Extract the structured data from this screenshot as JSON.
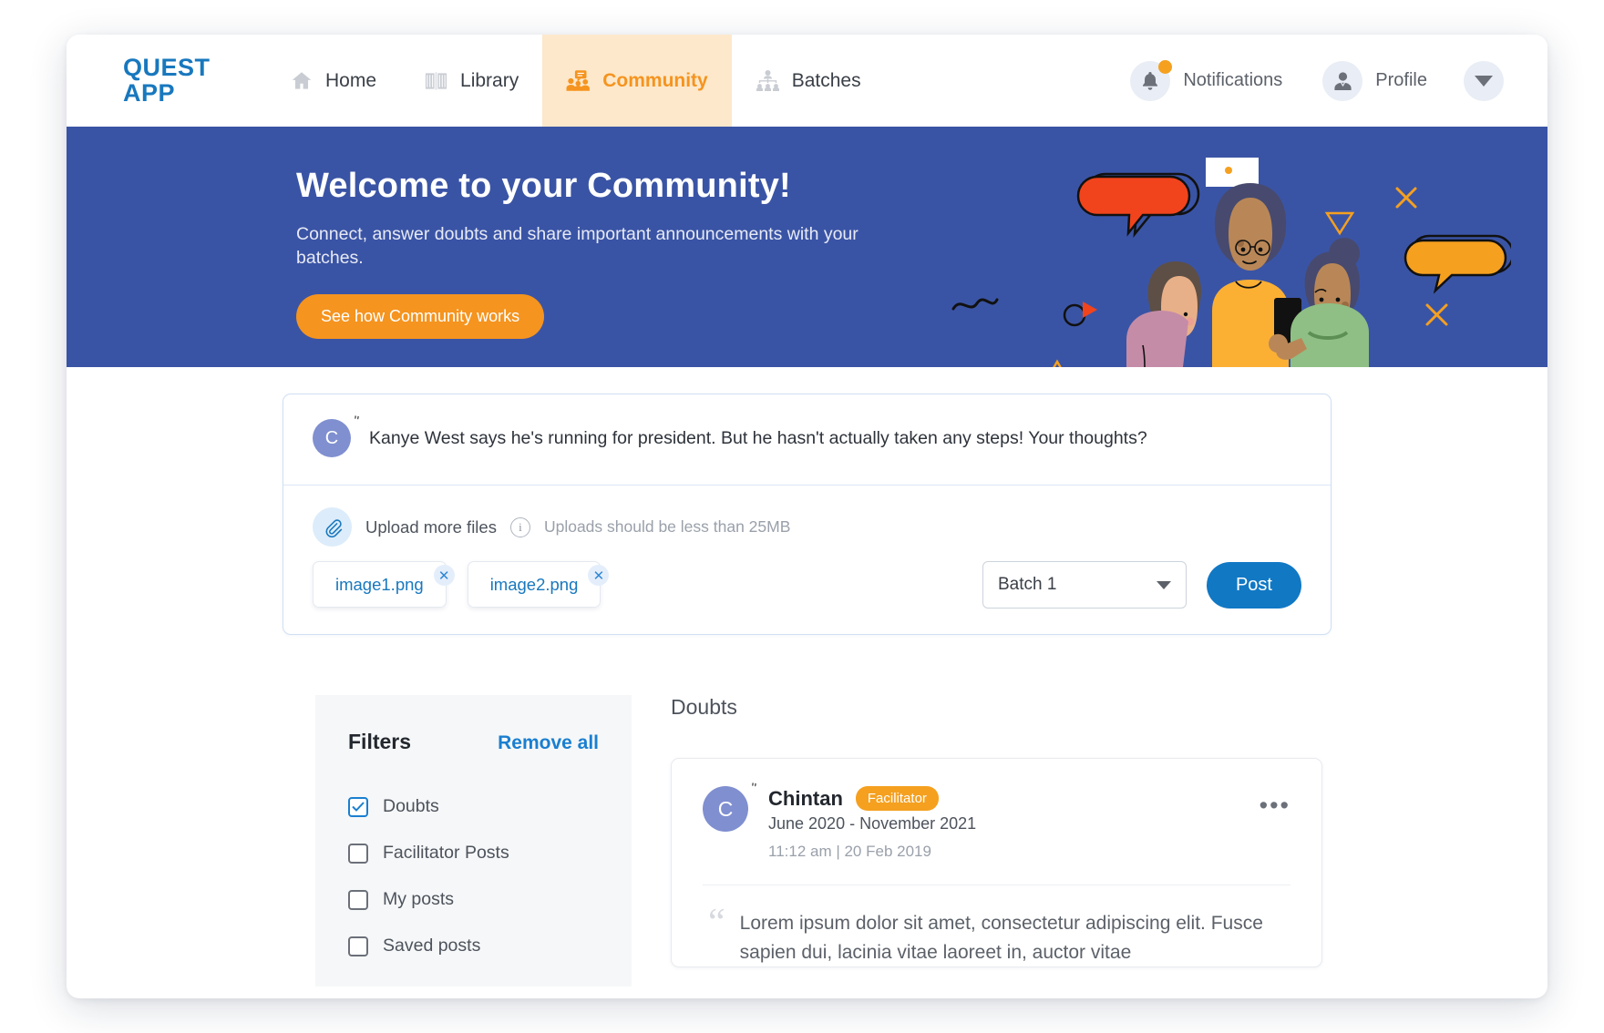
{
  "brand": {
    "line1": "QUEST",
    "line2": "APP"
  },
  "nav": {
    "items": [
      {
        "label": "Home",
        "icon": "home-icon",
        "active": false
      },
      {
        "label": "Library",
        "icon": "book-icon",
        "active": false
      },
      {
        "label": "Community",
        "icon": "community-icon",
        "active": true
      },
      {
        "label": "Batches",
        "icon": "org-chart-icon",
        "active": false
      }
    ],
    "notifications_label": "Notifications",
    "profile_label": "Profile",
    "has_unread": true
  },
  "hero": {
    "title": "Welcome to your Community!",
    "subtitle": "Connect, answer doubts and share important announcements with your batches.",
    "cta_label": "See how Community works",
    "background_color": "#3a54a5",
    "cta_color": "#f5941f"
  },
  "composer": {
    "avatar_initial": "C",
    "text": "Kanye West says he's running for president. But he hasn't actually taken any steps! Your thoughts?",
    "upload_label": "Upload more files",
    "upload_hint": "Uploads should be less than 25MB",
    "attachments": [
      {
        "name": "image1.png"
      },
      {
        "name": "image2.png"
      }
    ],
    "batch_selected": "Batch 1",
    "post_label": "Post"
  },
  "filters": {
    "title": "Filters",
    "remove_all_label": "Remove all",
    "options": [
      {
        "label": "Doubts",
        "checked": true
      },
      {
        "label": "Facilitator Posts",
        "checked": false
      },
      {
        "label": "My posts",
        "checked": false
      },
      {
        "label": "Saved posts",
        "checked": false
      }
    ]
  },
  "feed": {
    "section_title": "Doubts",
    "posts": [
      {
        "avatar_initial": "C",
        "author": "Chintan",
        "role_badge": "Facilitator",
        "date_range": "June 2020 - November 2021",
        "timestamp": "11:12 am | 20 Feb 2019",
        "body": "Lorem ipsum dolor sit amet, consectetur adipiscing elit. Fusce sapien dui, lacinia vitae laoreet in, auctor vitae",
        "menu_glyph": "•••"
      }
    ]
  },
  "colors": {
    "brand_blue": "#1878be",
    "accent_orange": "#f5941f",
    "hero_blue": "#3a54a5",
    "post_blue": "#1178c4"
  }
}
